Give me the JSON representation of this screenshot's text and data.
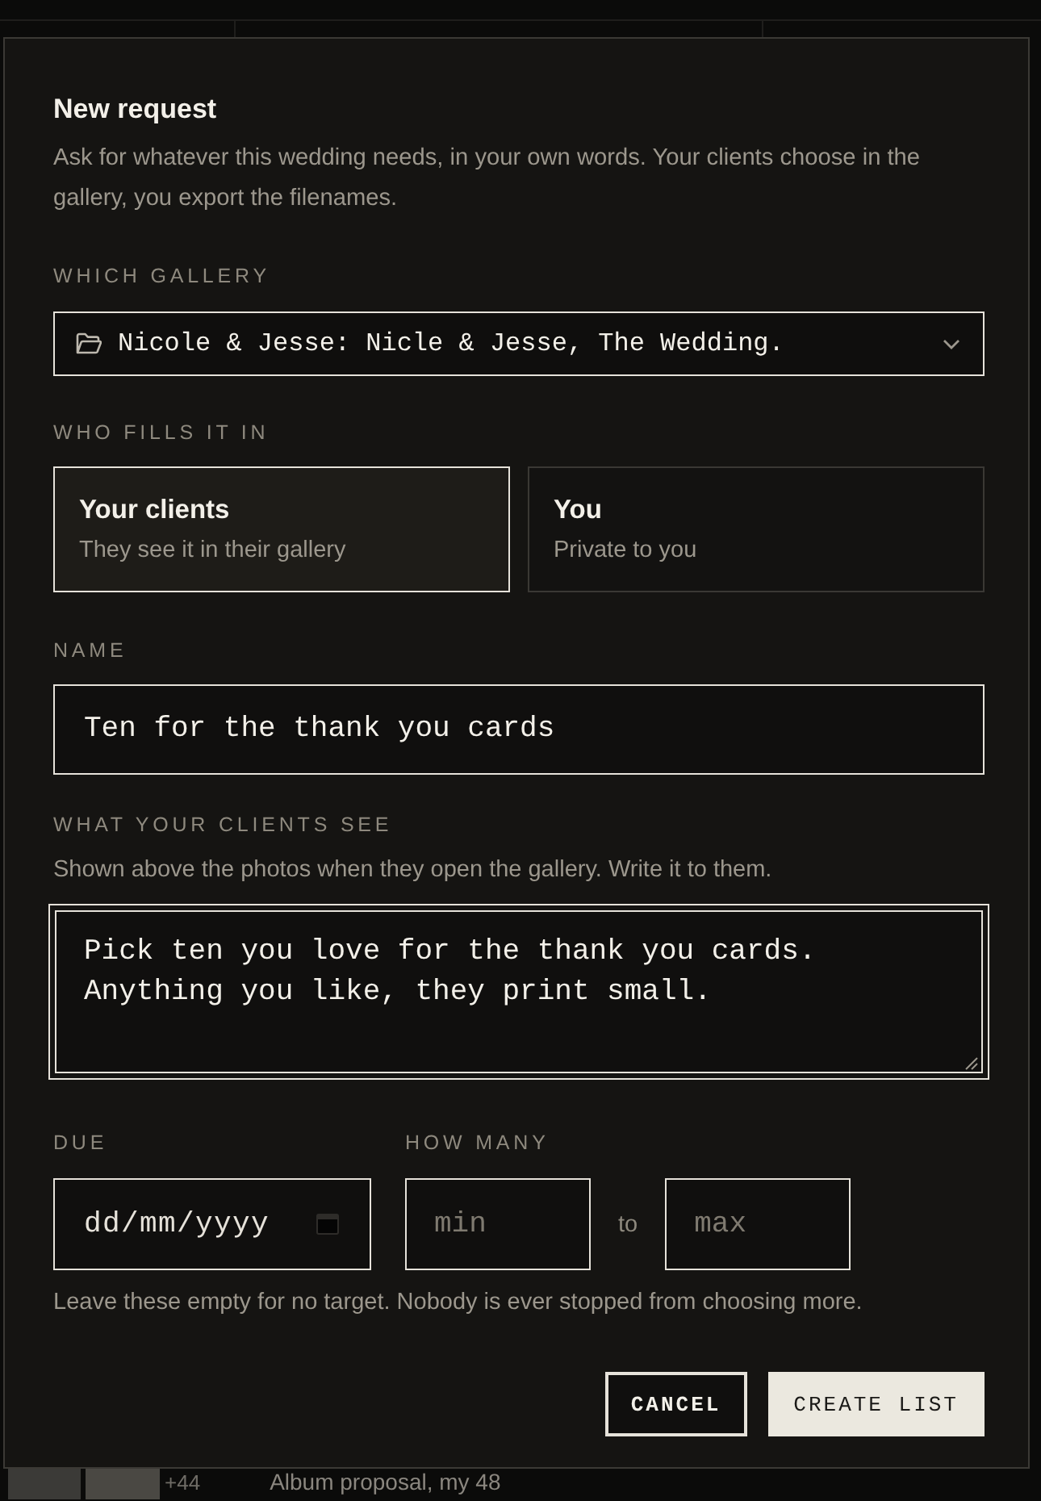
{
  "dialog": {
    "title": "New request",
    "description": "Ask for whatever this wedding needs, in your own words. Your clients choose in the gallery, you export the filenames."
  },
  "gallery": {
    "label": "WHICH GALLERY",
    "value": "Nicole & Jesse: Nicle & Jesse, The Wedding."
  },
  "audience": {
    "label": "WHO FILLS IT IN",
    "options": [
      {
        "title": "Your clients",
        "subtitle": "They see it in their gallery",
        "selected": true
      },
      {
        "title": "You",
        "subtitle": "Private to you",
        "selected": false
      }
    ]
  },
  "name": {
    "label": "NAME",
    "value": "Ten for the thank you cards"
  },
  "message": {
    "label": "WHAT YOUR CLIENTS SEE",
    "help": "Shown above the photos when they open the gallery. Write it to them.",
    "value": "Pick ten you love for the thank you cards. Anything you like, they print small.",
    "focused": true
  },
  "due": {
    "label": "DUE",
    "placeholder": "dd/mm/yyyy"
  },
  "count": {
    "label": "HOW MANY",
    "min": {
      "placeholder": "min"
    },
    "separator": "to",
    "max": {
      "placeholder": "max"
    }
  },
  "note": "Leave these empty for no target. Nobody is ever stopped from choosing more.",
  "buttons": [
    {
      "label": "CANCEL",
      "kind": "secondary"
    },
    {
      "label": "CREATE LIST",
      "kind": "primary"
    }
  ],
  "background": {
    "photo_count": "+44",
    "album_title": "Album proposal, my 48"
  }
}
